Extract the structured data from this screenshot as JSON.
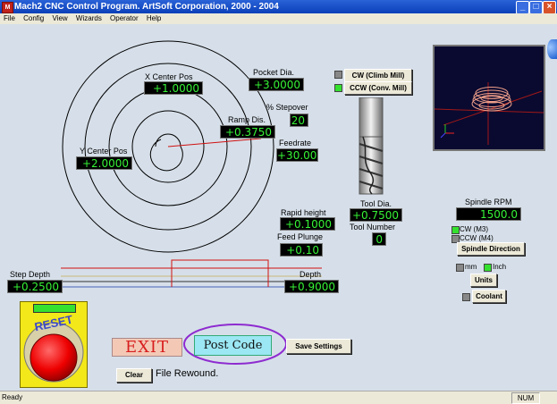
{
  "window": {
    "title": "Mach2 CNC Control Program. ArtSoft Corporation, 2000 - 2004",
    "app_icon": "M"
  },
  "menu": [
    "File",
    "Config",
    "View",
    "Wizards",
    "Operator",
    "Help"
  ],
  "fields": {
    "x_center": {
      "label": "X Center Pos",
      "value": "+1.0000"
    },
    "y_center": {
      "label": "Y Center Pos",
      "value": "+2.0000"
    },
    "pocket_dia": {
      "label": "Pocket Dia.",
      "value": "+3.0000"
    },
    "stepover": {
      "label": "% Stepover",
      "value": "20"
    },
    "ramp_dis": {
      "label": "Ramp Dis.",
      "value": "+0.3750"
    },
    "feedrate": {
      "label": "Feedrate",
      "value": "+30.00"
    },
    "rapid_height": {
      "label": "Rapid height",
      "value": "+0.1000"
    },
    "feed_plunge": {
      "label": "Feed Plunge",
      "value": "+0.10"
    },
    "tool_dia": {
      "label": "Tool Dia.",
      "value": "+0.7500"
    },
    "tool_number": {
      "label": "Tool Number",
      "value": "0"
    },
    "step_depth": {
      "label": "Step Depth",
      "value": "+0.2500"
    },
    "depth": {
      "label": "Depth",
      "value": "+0.9000"
    },
    "spindle_rpm": {
      "label": "Spindle RPM",
      "value": "1500.0"
    }
  },
  "buttons": {
    "cw_climb": "CW (Climb Mill)",
    "ccw_conv": "CCW (Conv. Mill)",
    "spindle_direction": "Spindle Direction",
    "units": "Units",
    "coolant": "Coolant",
    "save_settings": "Save Settings",
    "clear": "Clear",
    "exit": "EXIT",
    "post_code": "Post Code",
    "reset": "RESET"
  },
  "options": {
    "cw_m3": "CW (M3)",
    "ccw_m4": "CCW (M4)",
    "mm": "mm",
    "inch": "Inch"
  },
  "status": {
    "message": "File Rewound.",
    "bar_left": "Ready",
    "bar_right": "NUM"
  },
  "colors": {
    "dro_text": "#36f236",
    "led_on": "#35e12f",
    "exit_text": "#d81e1e",
    "post_code_bg": "#9be7f3",
    "highlight_ellipse": "#8e2bd0"
  }
}
